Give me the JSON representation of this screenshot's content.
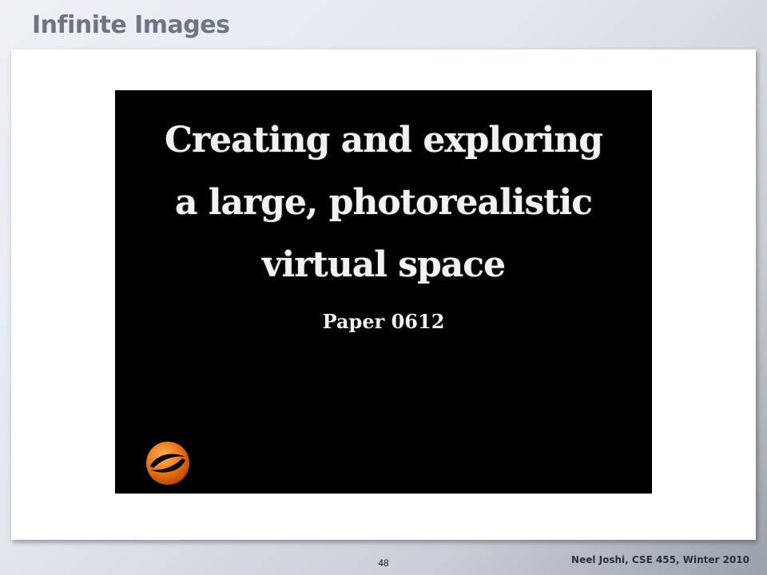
{
  "slide": {
    "title": "Infinite Images",
    "page_number": "48",
    "footer_credit": "Neel Joshi, CSE 455, Winter 2010"
  },
  "video": {
    "heading_lines": [
      "Creating and exploring",
      "a large, photorealistic",
      "virtual space"
    ],
    "paper_id": "Paper 0612",
    "logo_icon": "orange-swirl-logo-icon"
  },
  "colors": {
    "logo_orange": "#f07a1a",
    "video_background": "#000000",
    "title_gray": "#6e7480"
  }
}
